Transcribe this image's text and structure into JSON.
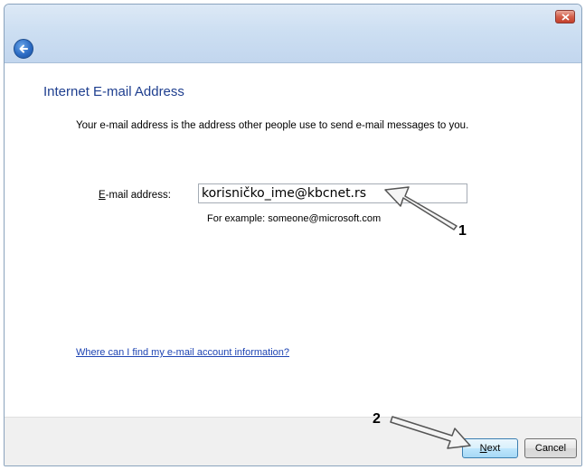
{
  "page": {
    "heading": "Internet E-mail Address",
    "description": "Your e-mail address is the address other people use to send e-mail messages to you.",
    "email_label_underlined": "E",
    "email_label_rest": "-mail address:",
    "email_value": "korisničko_ime@kbcnet.rs",
    "example_text": "For example: someone@microsoft.com",
    "help_link": "Where can I find my e-mail account information?"
  },
  "footer": {
    "next_underlined": "N",
    "next_rest": "ext",
    "cancel_label": "Cancel"
  },
  "annotations": {
    "marker_1": "1",
    "marker_2": "2"
  },
  "icons": {
    "back": "back-arrow-icon",
    "close": "close-icon"
  },
  "colors": {
    "heading": "#1f3f8f",
    "link": "#1f45b3",
    "close_button": "#d4604c",
    "back_button": "#2c6cc4"
  }
}
